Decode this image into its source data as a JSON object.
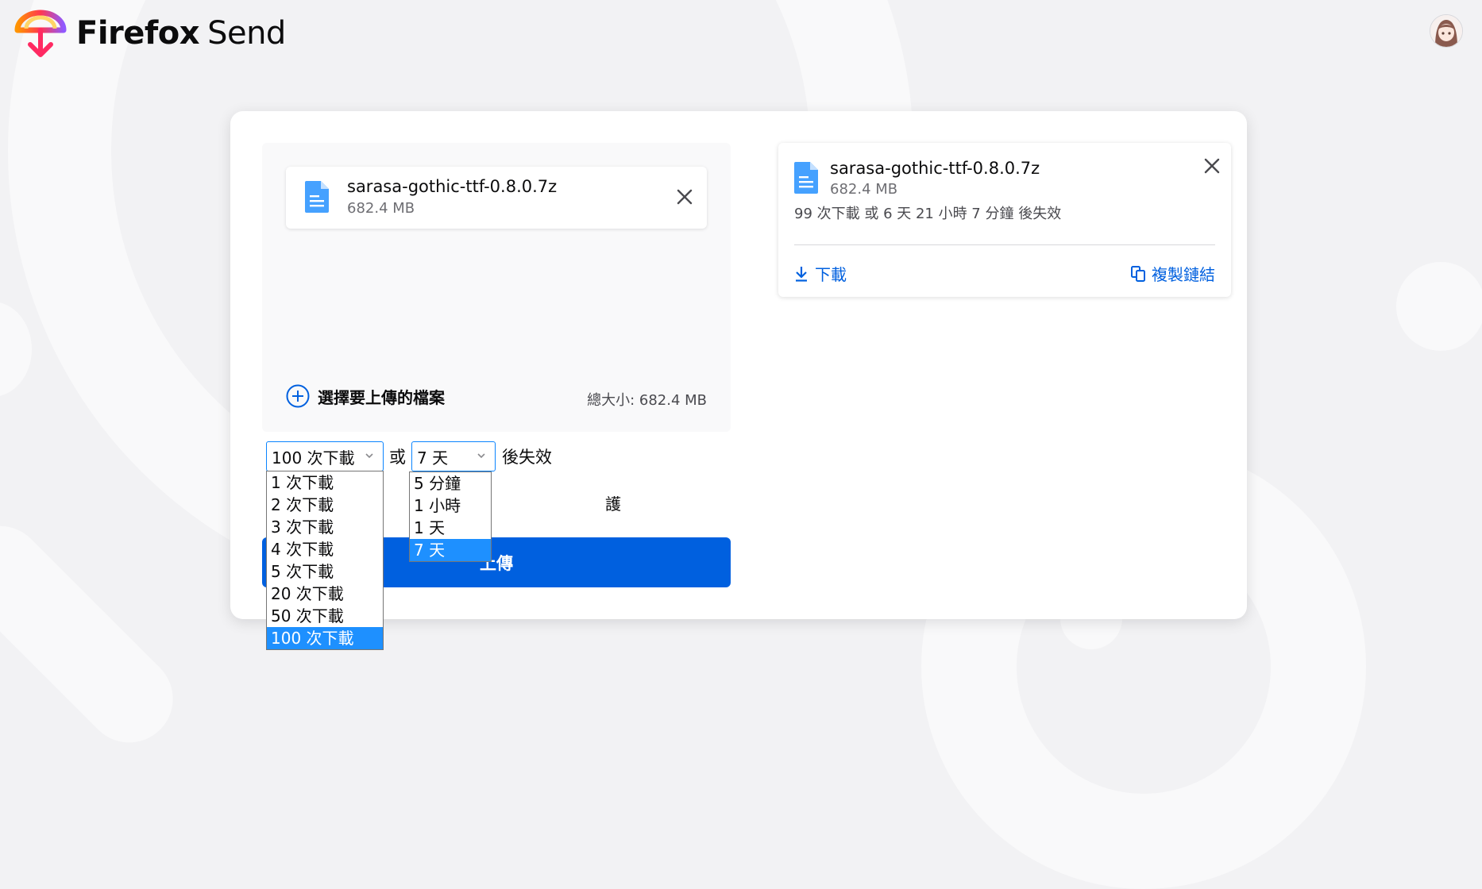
{
  "header": {
    "brand_strong": "Firefox",
    "brand_light": "Send",
    "logo_icon": "firefox-send-logo",
    "avatar_icon": "user-avatar"
  },
  "upload": {
    "file": {
      "name": "sarasa-gothic-ttf-0.8.0.7z",
      "size": "682.4 MB",
      "icon": "document-icon"
    },
    "add_files_label": "選擇要上傳的檔案",
    "total_size": "總大小: 682.4 MB",
    "downloads_select_value": "100 次下載",
    "or_text": "或",
    "time_select_value": "7 天",
    "expire_text": "後失效",
    "password_partial": "護",
    "upload_button": "上傳"
  },
  "downloads_dropdown": {
    "options": [
      "1 次下載",
      "2 次下載",
      "3 次下載",
      "4 次下載",
      "5 次下載",
      "20 次下載",
      "50 次下載",
      "100 次下載"
    ],
    "selected_index": 7
  },
  "time_dropdown": {
    "options": [
      "5 分鐘",
      "1 小時",
      "1 天",
      "7 天"
    ],
    "selected_index": 3
  },
  "uploaded": {
    "file_name": "sarasa-gothic-ttf-0.8.0.7z",
    "file_size": "682.4 MB",
    "expiry_info": "99 次下載 或 6 天 21 小時 7 分鐘 後失效",
    "download_label": "下載",
    "copy_link_label": "複製鏈結"
  },
  "colors": {
    "primary_blue": "#0060df",
    "select_border": "#0a84ff",
    "option_highlight": "#1e90ff",
    "background": "#f2f2f4"
  }
}
